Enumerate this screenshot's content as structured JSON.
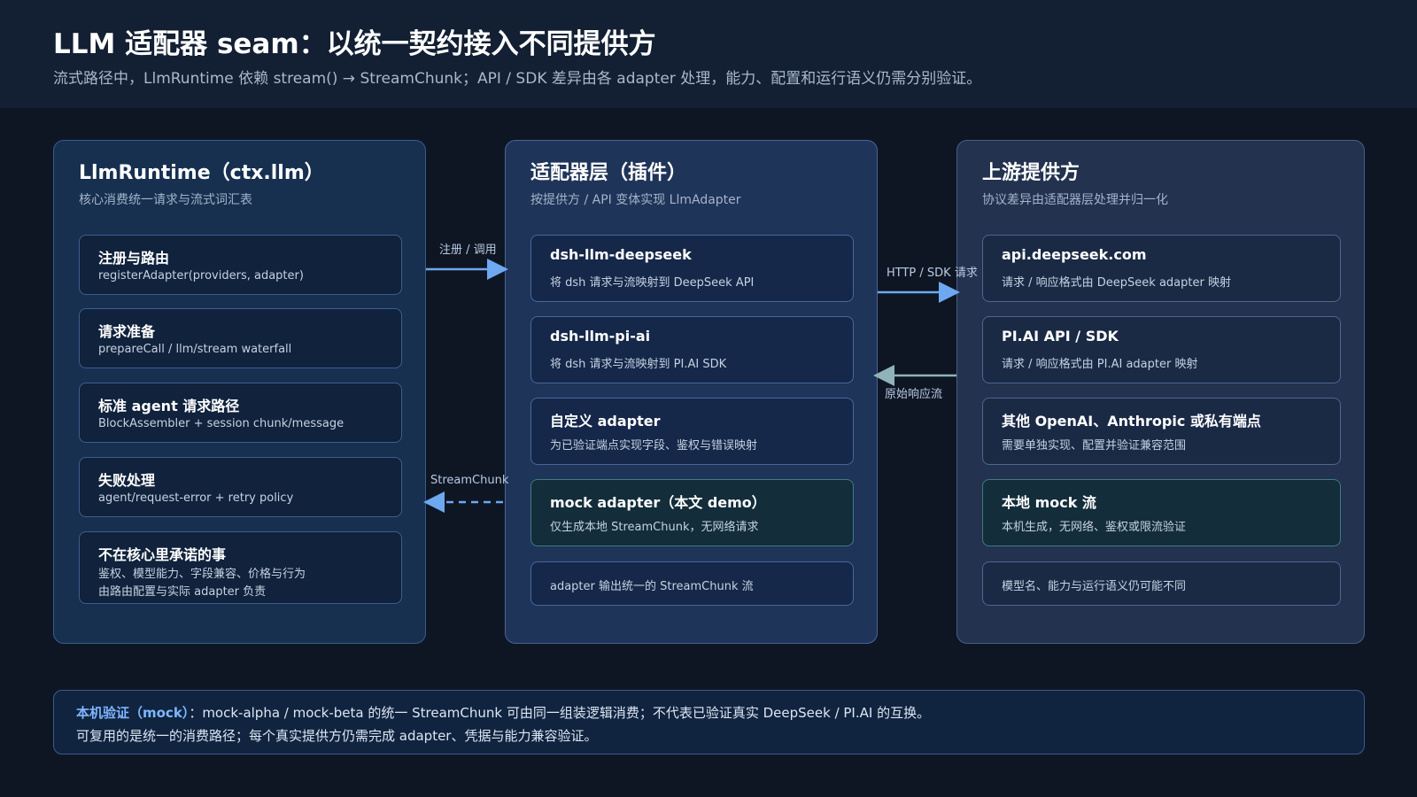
{
  "header": {
    "title": "LLM 适配器 seam：以统一契约接入不同提供方",
    "subtitle": "流式路径中，LlmRuntime 依赖 stream() → StreamChunk；API / SDK 差异由各 adapter 处理，能力、配置和运行语义仍需分别验证。"
  },
  "left_panel": {
    "title": "LlmRuntime（ctx.llm）",
    "subtitle": "核心消费统一请求与流式词汇表",
    "cards": [
      {
        "title": "注册与路由",
        "desc": "registerAdapter(providers, adapter)"
      },
      {
        "title": "请求准备",
        "desc": "prepareCall / llm/stream waterfall"
      },
      {
        "title": "标准 agent 请求路径",
        "desc": "BlockAssembler + session chunk/message"
      },
      {
        "title": "失败处理",
        "desc": "agent/request-error + retry policy"
      },
      {
        "title": "不在核心里承诺的事",
        "desc1": "鉴权、模型能力、字段兼容、价格与行为",
        "desc2": "由路由配置与实际 adapter 负责"
      }
    ]
  },
  "mid_panel": {
    "title": "适配器层（插件）",
    "subtitle": "按提供方 / API 变体实现 LlmAdapter",
    "cards": [
      {
        "title": "dsh-llm-deepseek",
        "desc": "将 dsh 请求与流映射到 DeepSeek API"
      },
      {
        "title": "dsh-llm-pi-ai",
        "desc": "将 dsh 请求与流映射到 PI.AI SDK"
      },
      {
        "title": "自定义 adapter",
        "desc": "为已验证端点实现字段、鉴权与错误映射"
      },
      {
        "title": "mock adapter（本文 demo）",
        "desc": "仅生成本地 StreamChunk，无网络请求"
      },
      {
        "desc": "adapter 输出统一的 StreamChunk 流"
      }
    ]
  },
  "right_panel": {
    "title": "上游提供方",
    "subtitle": "协议差异由适配器层处理并归一化",
    "cards": [
      {
        "title": "api.deepseek.com",
        "desc": "请求 / 响应格式由 DeepSeek adapter 映射"
      },
      {
        "title": "PI.AI API / SDK",
        "desc": "请求 / 响应格式由 PI.AI adapter 映射"
      },
      {
        "title": "其他 OpenAI、Anthropic 或私有端点",
        "desc": "需要单独实现、配置并验证兼容范围"
      },
      {
        "title": "本地 mock 流",
        "desc": "本机生成，无网络、鉴权或限流验证"
      },
      {
        "desc": "模型名、能力与运行语义仍可能不同"
      }
    ]
  },
  "arrows": {
    "register_call": "注册 / 调用",
    "stream_chunk": "StreamChunk",
    "http_sdk": "HTTP / SDK 请求",
    "raw_response": "原始响应流"
  },
  "footer": {
    "highlight": "本机验证（mock）",
    "line1_rest": "：mock-alpha / mock-beta 的统一 StreamChunk 可由同一组装逻辑消费；不代表已验证真实 DeepSeek / PI.AI 的互换。",
    "line2": "可复用的是统一的消费路径；每个真实提供方仍需完成 adapter、凭据与能力兼容验证。"
  },
  "colors": {
    "arrow_blue": "#6ea8f0",
    "arrow_teal": "#8fb3b8",
    "accent": "#7fb6ff"
  }
}
